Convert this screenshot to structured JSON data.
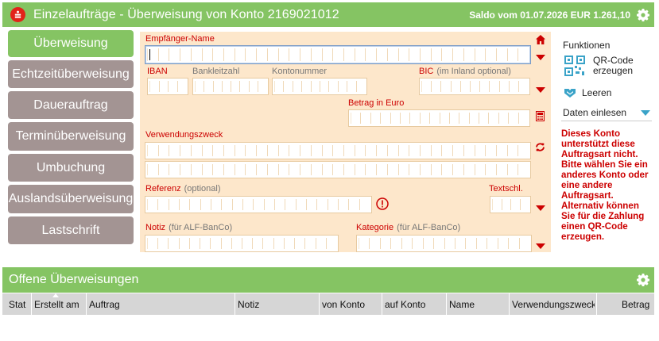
{
  "header": {
    "title": "Einzelaufträge - Überweisung von Konto 2169021012",
    "saldo": "Saldo vom 01.07.2026 EUR 1.261,10",
    "settings_icon": "gear-icon",
    "logo_icon": "sparkasse-logo-icon"
  },
  "nav": {
    "items": [
      {
        "label": "Überweisung"
      },
      {
        "label": "Echtzeitüberweisung"
      },
      {
        "label": "Dauerauftrag"
      },
      {
        "label": "Terminüberweisung"
      },
      {
        "label": "Umbuchung"
      },
      {
        "label": "Auslandsüberweisung"
      },
      {
        "label": "Lastschrift"
      }
    ]
  },
  "form": {
    "recipient_label": "Empfänger-Name",
    "iban_label": "IBAN",
    "blz_label": "Bankleitzahl",
    "konto_label": "Kontonummer",
    "bic_label": "BIC",
    "bic_hint": "(im Inland optional)",
    "amount_label": "Betrag in Euro",
    "purpose_label": "Verwendungszweck",
    "reference_label": "Referenz",
    "reference_hint": "(optional)",
    "textkey_label": "Textschl.",
    "note_label": "Notiz",
    "note_hint": "(für ALF-BanCo)",
    "category_label": "Kategorie",
    "category_hint": "(für ALF-BanCo)",
    "recipient_value": "",
    "amount_value": ""
  },
  "panel": {
    "functions_label": "Funktionen",
    "qr_label_line1": "QR-Code",
    "qr_label_line2": "erzeugen",
    "clear_label": "Leeren",
    "import_label": "Daten einlesen",
    "warning": "Dieses Konto unterstützt diese Auftragsart nicht. Bitte wählen Sie ein anderes Konto oder eine andere Auftragsart. Alternativ können Sie für die Zahlung einen QR-Code erzeugen."
  },
  "pending": {
    "title": "Offene Überweisungen",
    "columns": [
      "Stat",
      "Erstellt am",
      "Auftrag",
      "Notiz",
      "von Konto",
      "auf Konto",
      "Name",
      "Verwendungszweck",
      "Betrag"
    ]
  },
  "colors": {
    "brand_green": "#85c463",
    "nav_grey": "#a39493",
    "form_bg": "#fde7cb",
    "accent_red": "#cc0000",
    "sparkasse_red": "#e2231a"
  }
}
